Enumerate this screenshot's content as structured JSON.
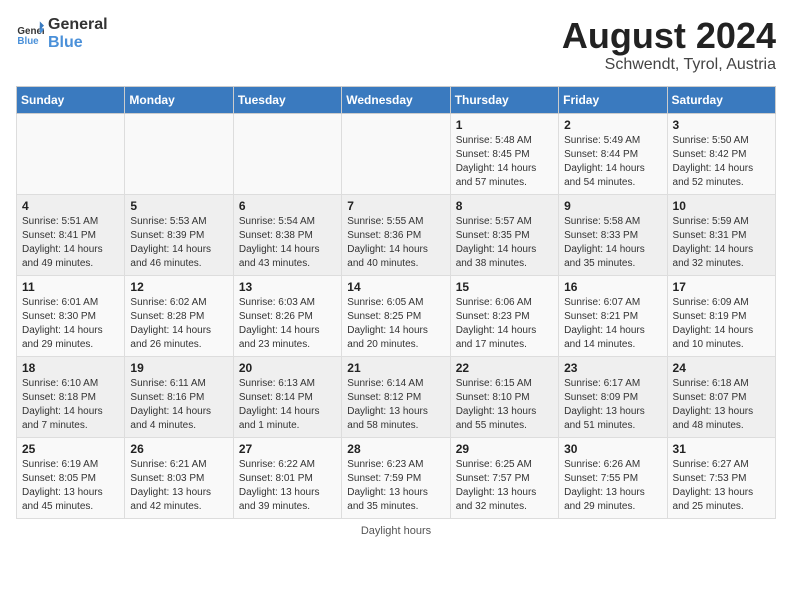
{
  "header": {
    "logo_line1": "General",
    "logo_line2": "Blue",
    "main_title": "August 2024",
    "sub_title": "Schwendt, Tyrol, Austria"
  },
  "calendar": {
    "days_of_week": [
      "Sunday",
      "Monday",
      "Tuesday",
      "Wednesday",
      "Thursday",
      "Friday",
      "Saturday"
    ],
    "weeks": [
      [
        {
          "day": "",
          "info": ""
        },
        {
          "day": "",
          "info": ""
        },
        {
          "day": "",
          "info": ""
        },
        {
          "day": "",
          "info": ""
        },
        {
          "day": "1",
          "info": "Sunrise: 5:48 AM\nSunset: 8:45 PM\nDaylight: 14 hours and 57 minutes."
        },
        {
          "day": "2",
          "info": "Sunrise: 5:49 AM\nSunset: 8:44 PM\nDaylight: 14 hours and 54 minutes."
        },
        {
          "day": "3",
          "info": "Sunrise: 5:50 AM\nSunset: 8:42 PM\nDaylight: 14 hours and 52 minutes."
        }
      ],
      [
        {
          "day": "4",
          "info": "Sunrise: 5:51 AM\nSunset: 8:41 PM\nDaylight: 14 hours and 49 minutes."
        },
        {
          "day": "5",
          "info": "Sunrise: 5:53 AM\nSunset: 8:39 PM\nDaylight: 14 hours and 46 minutes."
        },
        {
          "day": "6",
          "info": "Sunrise: 5:54 AM\nSunset: 8:38 PM\nDaylight: 14 hours and 43 minutes."
        },
        {
          "day": "7",
          "info": "Sunrise: 5:55 AM\nSunset: 8:36 PM\nDaylight: 14 hours and 40 minutes."
        },
        {
          "day": "8",
          "info": "Sunrise: 5:57 AM\nSunset: 8:35 PM\nDaylight: 14 hours and 38 minutes."
        },
        {
          "day": "9",
          "info": "Sunrise: 5:58 AM\nSunset: 8:33 PM\nDaylight: 14 hours and 35 minutes."
        },
        {
          "day": "10",
          "info": "Sunrise: 5:59 AM\nSunset: 8:31 PM\nDaylight: 14 hours and 32 minutes."
        }
      ],
      [
        {
          "day": "11",
          "info": "Sunrise: 6:01 AM\nSunset: 8:30 PM\nDaylight: 14 hours and 29 minutes."
        },
        {
          "day": "12",
          "info": "Sunrise: 6:02 AM\nSunset: 8:28 PM\nDaylight: 14 hours and 26 minutes."
        },
        {
          "day": "13",
          "info": "Sunrise: 6:03 AM\nSunset: 8:26 PM\nDaylight: 14 hours and 23 minutes."
        },
        {
          "day": "14",
          "info": "Sunrise: 6:05 AM\nSunset: 8:25 PM\nDaylight: 14 hours and 20 minutes."
        },
        {
          "day": "15",
          "info": "Sunrise: 6:06 AM\nSunset: 8:23 PM\nDaylight: 14 hours and 17 minutes."
        },
        {
          "day": "16",
          "info": "Sunrise: 6:07 AM\nSunset: 8:21 PM\nDaylight: 14 hours and 14 minutes."
        },
        {
          "day": "17",
          "info": "Sunrise: 6:09 AM\nSunset: 8:19 PM\nDaylight: 14 hours and 10 minutes."
        }
      ],
      [
        {
          "day": "18",
          "info": "Sunrise: 6:10 AM\nSunset: 8:18 PM\nDaylight: 14 hours and 7 minutes."
        },
        {
          "day": "19",
          "info": "Sunrise: 6:11 AM\nSunset: 8:16 PM\nDaylight: 14 hours and 4 minutes."
        },
        {
          "day": "20",
          "info": "Sunrise: 6:13 AM\nSunset: 8:14 PM\nDaylight: 14 hours and 1 minute."
        },
        {
          "day": "21",
          "info": "Sunrise: 6:14 AM\nSunset: 8:12 PM\nDaylight: 13 hours and 58 minutes."
        },
        {
          "day": "22",
          "info": "Sunrise: 6:15 AM\nSunset: 8:10 PM\nDaylight: 13 hours and 55 minutes."
        },
        {
          "day": "23",
          "info": "Sunrise: 6:17 AM\nSunset: 8:09 PM\nDaylight: 13 hours and 51 minutes."
        },
        {
          "day": "24",
          "info": "Sunrise: 6:18 AM\nSunset: 8:07 PM\nDaylight: 13 hours and 48 minutes."
        }
      ],
      [
        {
          "day": "25",
          "info": "Sunrise: 6:19 AM\nSunset: 8:05 PM\nDaylight: 13 hours and 45 minutes."
        },
        {
          "day": "26",
          "info": "Sunrise: 6:21 AM\nSunset: 8:03 PM\nDaylight: 13 hours and 42 minutes."
        },
        {
          "day": "27",
          "info": "Sunrise: 6:22 AM\nSunset: 8:01 PM\nDaylight: 13 hours and 39 minutes."
        },
        {
          "day": "28",
          "info": "Sunrise: 6:23 AM\nSunset: 7:59 PM\nDaylight: 13 hours and 35 minutes."
        },
        {
          "day": "29",
          "info": "Sunrise: 6:25 AM\nSunset: 7:57 PM\nDaylight: 13 hours and 32 minutes."
        },
        {
          "day": "30",
          "info": "Sunrise: 6:26 AM\nSunset: 7:55 PM\nDaylight: 13 hours and 29 minutes."
        },
        {
          "day": "31",
          "info": "Sunrise: 6:27 AM\nSunset: 7:53 PM\nDaylight: 13 hours and 25 minutes."
        }
      ]
    ]
  },
  "footer": {
    "note": "Daylight hours"
  }
}
